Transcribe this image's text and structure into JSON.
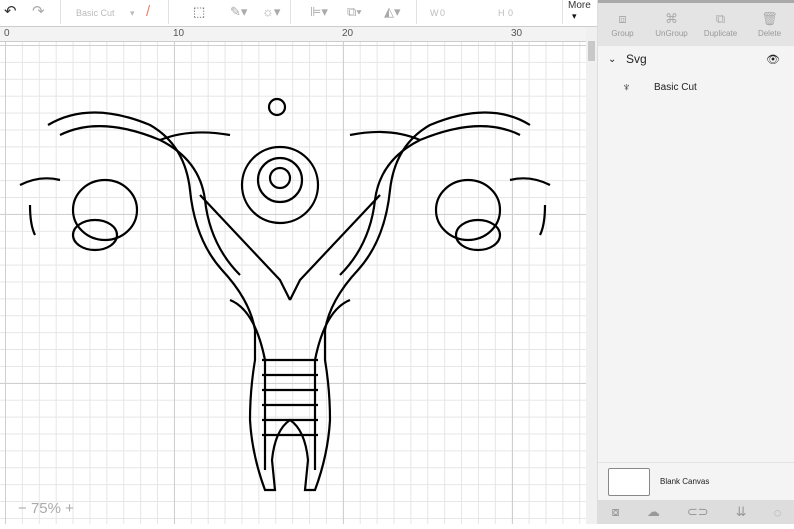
{
  "toolbar": {
    "undo": "↶",
    "redo": "↷",
    "operation": "Basic Cut",
    "w_label": "W",
    "w_value": "0",
    "h_label": "H",
    "h_value": "0",
    "more": "More"
  },
  "ruler": {
    "ticks": [
      "0",
      "10",
      "20",
      "30"
    ]
  },
  "zoom": {
    "minus": "−",
    "level": "75%",
    "plus": "+"
  },
  "panel": {
    "actions": [
      {
        "label": "Group",
        "icon": "group-icon"
      },
      {
        "label": "UnGroup",
        "icon": "ungroup-icon"
      },
      {
        "label": "Duplicate",
        "icon": "duplicate-icon"
      },
      {
        "label": "Delete",
        "icon": "delete-icon"
      }
    ],
    "layer_group": "Svg",
    "layer_item": "Basic Cut",
    "canvas_label": "Blank Canvas"
  }
}
